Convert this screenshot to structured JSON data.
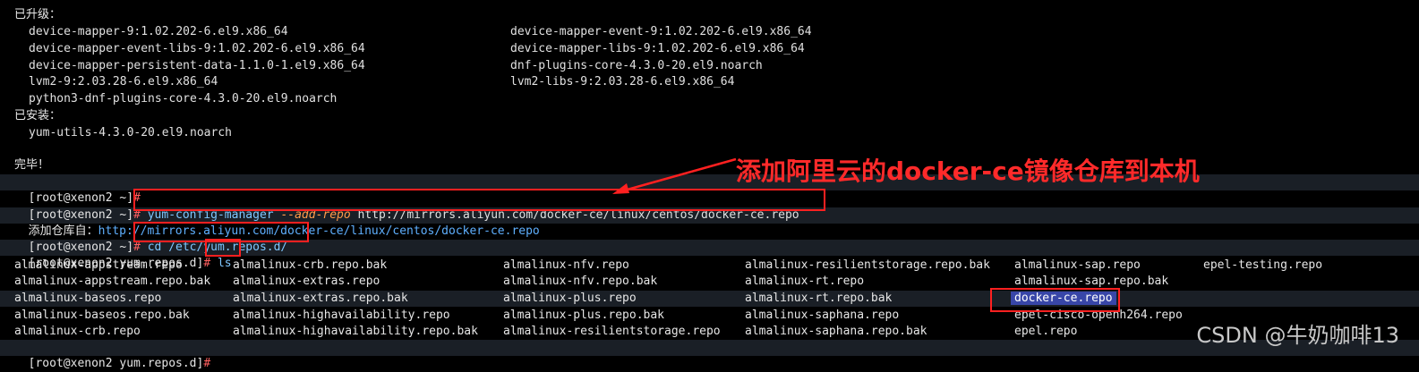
{
  "upgraded_header": "已升级：",
  "upgraded": [
    [
      "device-mapper-9:1.02.202-6.el9.x86_64",
      "device-mapper-event-9:1.02.202-6.el9.x86_64"
    ],
    [
      "device-mapper-event-libs-9:1.02.202-6.el9.x86_64",
      "device-mapper-libs-9:1.02.202-6.el9.x86_64"
    ],
    [
      "device-mapper-persistent-data-1.1.0-1.el9.x86_64",
      "dnf-plugins-core-4.3.0-20.el9.noarch"
    ],
    [
      "lvm2-9:2.03.28-6.el9.x86_64",
      "lvm2-libs-9:2.03.28-6.el9.x86_64"
    ],
    [
      "python3-dnf-plugins-core-4.3.0-20.el9.noarch",
      ""
    ]
  ],
  "installed_header": "已安装：",
  "installed": [
    "yum-utils-4.3.0-20.el9.noarch"
  ],
  "done": "完毕！",
  "prompt_home": "[root@xenon2 ~]",
  "prompt_repos": "[root@xenon2 yum.repos.d]",
  "hash": "#",
  "cmd1": {
    "name": "yum-config-manager",
    "opt": "--add-repo",
    "arg": "http://mirrors.aliyun.com/docker-ce/linux/centos/docker-ce.repo"
  },
  "add_repo_msg": {
    "prefix": "添加仓库自：",
    "url": "http://mirrors.aliyun.com/docker-ce/linux/centos/docker-ce.repo"
  },
  "cmd2": "cd /etc/yum.repos.d/",
  "cmd3": "ls",
  "ls_rows": [
    [
      "almalinux-appstream.repo",
      "almalinux-crb.repo.bak",
      "almalinux-nfv.repo",
      "almalinux-resilientstorage.repo.bak",
      "almalinux-sap.repo",
      "epel-testing.repo"
    ],
    [
      "almalinux-appstream.repo.bak",
      "almalinux-extras.repo",
      "almalinux-nfv.repo.bak",
      "almalinux-rt.repo",
      "almalinux-sap.repo.bak",
      ""
    ],
    [
      "almalinux-baseos.repo",
      "almalinux-extras.repo.bak",
      "almalinux-plus.repo",
      "almalinux-rt.repo.bak",
      "docker-ce.repo",
      ""
    ],
    [
      "almalinux-baseos.repo.bak",
      "almalinux-highavailability.repo",
      "almalinux-plus.repo.bak",
      "almalinux-saphana.repo",
      "epel-cisco-openh264.repo",
      ""
    ],
    [
      "almalinux-crb.repo",
      "almalinux-highavailability.repo.bak",
      "almalinux-resilientstorage.repo",
      "almalinux-saphana.repo.bak",
      "epel.repo",
      ""
    ]
  ],
  "annotation": "添加阿里云的docker-ce镜像仓库到本机",
  "watermark": "CSDN @牛奶咖啡13",
  "colors": {
    "annotation": "#ff2a2a",
    "selection": "#3846a8",
    "box": "#ff2020"
  }
}
